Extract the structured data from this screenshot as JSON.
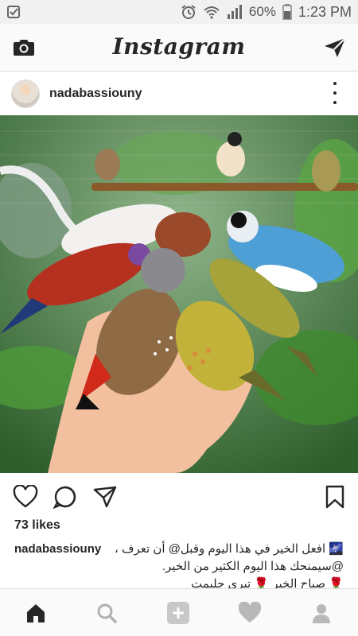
{
  "status_bar": {
    "battery": "60%",
    "time": "1:23 PM"
  },
  "header": {
    "title": "Instagram"
  },
  "post": {
    "username": "nadabassiouny",
    "likes": "73 likes",
    "caption_user": "nadabassiouny",
    "caption_line1": "🌌 افعل الخير في هذا اليوم وقبل@ أن تعرف ،",
    "caption_line2": "@سيمنحك هذا اليوم الكثير من الخير.",
    "caption_line3": "🌹 صباح الخير 🌹 تيري جلبمت"
  },
  "colors": {
    "text": "#262626",
    "bar_background": "#fafafa",
    "divider": "#dbdbdb",
    "inactive_nav": "#b0b0b0"
  },
  "icons": {
    "camera": "camera-icon",
    "direct": "paper-plane-icon",
    "heart": "heart-icon",
    "comment": "comment-icon",
    "share": "share-icon",
    "bookmark": "bookmark-icon",
    "home": "home-icon",
    "search": "search-icon",
    "add": "add-post-icon",
    "activity": "activity-heart-icon",
    "profile": "profile-icon"
  }
}
